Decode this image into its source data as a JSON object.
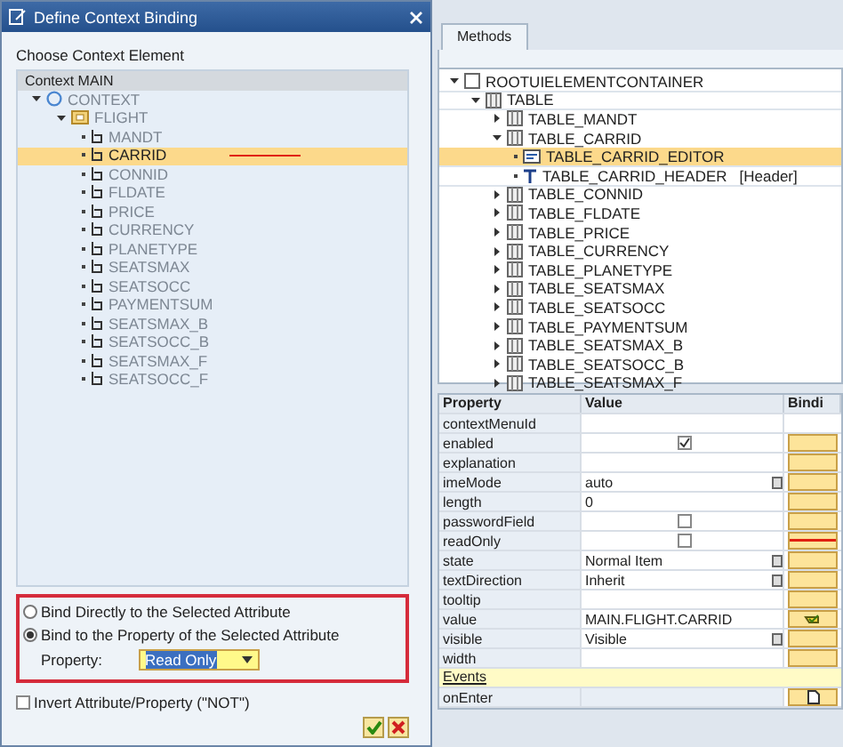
{
  "dialog": {
    "title": "Define Context Binding",
    "prompt": "Choose Context Element",
    "tree_header": "Context MAIN",
    "tree": [
      {
        "label": "CONTEXT",
        "kind": "root",
        "expanded": true,
        "selected": false,
        "children": [
          {
            "label": "FLIGHT",
            "kind": "node",
            "expanded": true,
            "selected": false,
            "children": [
              {
                "label": "MANDT",
                "kind": "attribute",
                "selected": false
              },
              {
                "label": "CARRID",
                "kind": "attribute",
                "selected": true,
                "annotated": true
              },
              {
                "label": "CONNID",
                "kind": "attribute",
                "selected": false
              },
              {
                "label": "FLDATE",
                "kind": "attribute",
                "selected": false
              },
              {
                "label": "PRICE",
                "kind": "attribute",
                "selected": false
              },
              {
                "label": "CURRENCY",
                "kind": "attribute",
                "selected": false
              },
              {
                "label": "PLANETYPE",
                "kind": "attribute",
                "selected": false
              },
              {
                "label": "SEATSMAX",
                "kind": "attribute",
                "selected": false
              },
              {
                "label": "SEATSOCC",
                "kind": "attribute",
                "selected": false
              },
              {
                "label": "PAYMENTSUM",
                "kind": "attribute",
                "selected": false
              },
              {
                "label": "SEATSMAX_B",
                "kind": "attribute",
                "selected": false
              },
              {
                "label": "SEATSOCC_B",
                "kind": "attribute",
                "selected": false
              },
              {
                "label": "SEATSMAX_F",
                "kind": "attribute",
                "selected": false
              },
              {
                "label": "SEATSOCC_F",
                "kind": "attribute",
                "selected": false
              }
            ]
          }
        ]
      }
    ],
    "options": [
      {
        "label": "Bind Directly to the Selected Attribute",
        "selected": false
      },
      {
        "label": "Bind to the Property of the Selected Attribute",
        "selected": true
      }
    ],
    "property_label": "Property:",
    "property_value": "Read Only",
    "invert": {
      "label": "Invert Attribute/Property (\"NOT\")",
      "checked": false
    }
  },
  "tabs": [
    {
      "label": "Methods",
      "selected": true
    }
  ],
  "ui_tree": [
    {
      "label": "ROOTUIELEMENTCONTAINER",
      "kind": "container",
      "expanded": true,
      "selected": false,
      "children": [
        {
          "label": "TABLE",
          "kind": "table",
          "expanded": true,
          "selected": false,
          "children": [
            {
              "label": "TABLE_MANDT",
              "kind": "column",
              "expanded": false,
              "selected": false
            },
            {
              "label": "TABLE_CARRID",
              "kind": "column",
              "expanded": true,
              "selected": false,
              "children": [
                {
                  "label": "TABLE_CARRID_EDITOR",
                  "kind": "editor",
                  "selected": true
                },
                {
                  "label": "TABLE_CARRID_HEADER",
                  "kind": "header",
                  "selected": false,
                  "note": "[Header]"
                }
              ]
            },
            {
              "label": "TABLE_CONNID",
              "kind": "column",
              "expanded": false,
              "selected": false
            },
            {
              "label": "TABLE_FLDATE",
              "kind": "column",
              "expanded": false,
              "selected": false
            },
            {
              "label": "TABLE_PRICE",
              "kind": "column",
              "expanded": false,
              "selected": false
            },
            {
              "label": "TABLE_CURRENCY",
              "kind": "column",
              "expanded": false,
              "selected": false
            },
            {
              "label": "TABLE_PLANETYPE",
              "kind": "column",
              "expanded": false,
              "selected": false
            },
            {
              "label": "TABLE_SEATSMAX",
              "kind": "column",
              "expanded": false,
              "selected": false
            },
            {
              "label": "TABLE_SEATSOCC",
              "kind": "column",
              "expanded": false,
              "selected": false
            },
            {
              "label": "TABLE_PAYMENTSUM",
              "kind": "column",
              "expanded": false,
              "selected": false
            },
            {
              "label": "TABLE_SEATSMAX_B",
              "kind": "column",
              "expanded": false,
              "selected": false
            },
            {
              "label": "TABLE_SEATSOCC_B",
              "kind": "column",
              "expanded": false,
              "selected": false
            },
            {
              "label": "TABLE_SEATSMAX_F",
              "kind": "column",
              "expanded": false,
              "selected": false
            }
          ]
        }
      ]
    }
  ],
  "properties": {
    "columns": [
      "Property",
      "Value",
      "Bindi"
    ],
    "rows": [
      {
        "name": "contextMenuId",
        "kind": "text"
      },
      {
        "name": "enabled",
        "kind": "checkbox",
        "checked": true,
        "binding": {
          "kind": "button"
        }
      },
      {
        "name": "explanation",
        "kind": "text",
        "binding": {
          "kind": "button"
        }
      },
      {
        "name": "imeMode",
        "kind": "dropdown",
        "value": "auto",
        "binding": {
          "kind": "button"
        }
      },
      {
        "name": "length",
        "kind": "text",
        "value": "0",
        "binding": {
          "kind": "button"
        }
      },
      {
        "name": "passwordField",
        "kind": "checkbox",
        "checked": false,
        "binding": {
          "kind": "button"
        }
      },
      {
        "name": "readOnly",
        "kind": "checkbox",
        "checked": false,
        "binding": {
          "kind": "marked"
        }
      },
      {
        "name": "state",
        "kind": "dropdown",
        "value": "Normal Item",
        "binding": {
          "kind": "button"
        }
      },
      {
        "name": "textDirection",
        "kind": "dropdown",
        "value": "Inherit",
        "binding": {
          "kind": "button"
        }
      },
      {
        "name": "tooltip",
        "kind": "text",
        "binding": {
          "kind": "button"
        }
      },
      {
        "name": "value",
        "kind": "text",
        "value": "MAIN.FLIGHT.CARRID",
        "binding": {
          "kind": "bound"
        }
      },
      {
        "name": "visible",
        "kind": "dropdown",
        "value": "Visible",
        "binding": {
          "kind": "button"
        }
      },
      {
        "name": "width",
        "kind": "text",
        "binding": {
          "kind": "button"
        }
      },
      {
        "name": "Events",
        "kind": "section"
      },
      {
        "name": "onEnter",
        "kind": "event",
        "binding": {
          "kind": "create"
        }
      }
    ]
  }
}
